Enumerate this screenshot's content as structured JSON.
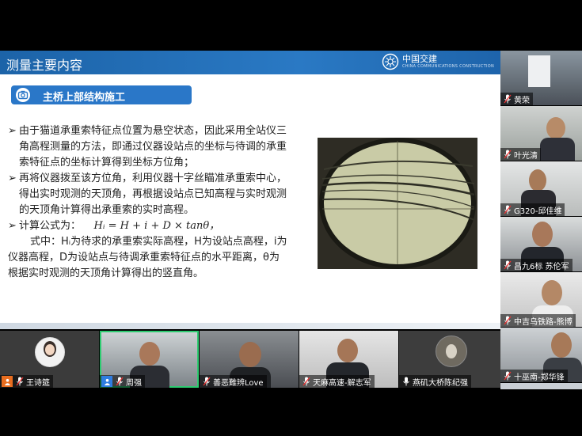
{
  "slide": {
    "title": "测量主要内容",
    "brand": {
      "name": "中国交建",
      "sub": "CHINA COMMUNICATIONS CONSTRUCTION"
    },
    "section": "主桥上部结构施工",
    "bullets": [
      {
        "marker": "➢",
        "lines": [
          "由于猫道承重索特征点位置为悬空状态，因此采用全站仪三",
          "角高程测量的方法，即通过仪器设站点的坐标与待调的承重",
          "索特征点的坐标计算得到坐标方位角；"
        ]
      },
      {
        "marker": "➢",
        "lines": [
          "再将仪器拨至该方位角，利用仪器十字丝瞄准承重索中心，",
          "得出实时观测的天顶角，再根据设站点已知高程与实时观测",
          "的天顶角计算得出承重索的实时高程。"
        ]
      }
    ],
    "formula_label": "计算公式为：",
    "formula": "Hᵢ = H + i + D × tanθ，",
    "explain": [
      "式中：Hᵢ为待求的承重索实际高程，H为设站点高程，i为",
      "仪器高程，D为设站点与待调承重索特征点的水平距离，θ为",
      "根据实时观测的天顶角计算得出的竖直角。"
    ]
  },
  "right_participants": [
    {
      "name": "黄荣"
    },
    {
      "name": "叶光清"
    },
    {
      "name": "G320-邱佳维"
    },
    {
      "name": "昌九6标 苏伦军"
    },
    {
      "name": "中吉乌铁路-熊博"
    },
    {
      "name": "十巫南-郑华锋"
    }
  ],
  "bottom_participants": [
    {
      "name": "王诗筵"
    },
    {
      "name": "周强"
    },
    {
      "name": "善恶難辨Love"
    },
    {
      "name": "天麻高速-解志军"
    },
    {
      "name": "燕矶大桥陈纪强"
    }
  ],
  "colors": {
    "slide_blue": "#1c63a8",
    "active_speaker": "#2ecc71",
    "host_badge": "#e86d1f"
  },
  "icons": [
    "camera-icon",
    "mic-icon",
    "host-badge-icon",
    "user-badge-icon",
    "brand-logo-icon"
  ]
}
